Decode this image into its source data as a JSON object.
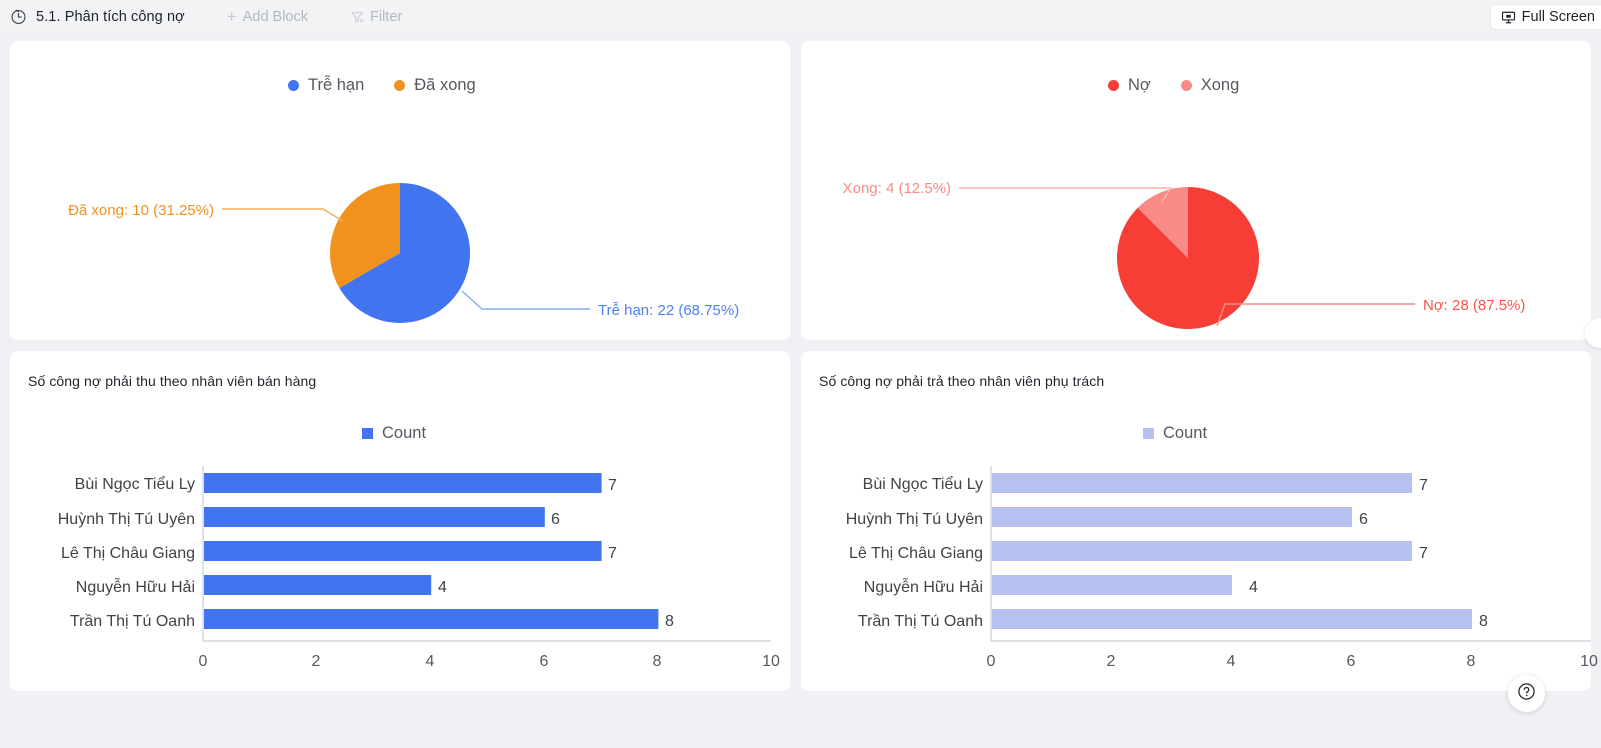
{
  "topbar": {
    "clock_icon": "clock-icon",
    "title": "5.1. Phân tích công nợ",
    "add_block_label": "Add Block",
    "add_block_icon": "plus-icon",
    "filter_label": "Filter",
    "filter_icon": "filter-icon",
    "fullscreen_label": "Full Screen",
    "fullscreen_icon": "presentation-screen-icon"
  },
  "colors": {
    "blue": "#4174ee",
    "orange": "#f1921f",
    "red": "#f73e36",
    "light_red": "#f98b85",
    "light_blue": "#b6c1ef",
    "page_bg": "#f0f1f4",
    "panel_bg": "#ffffff",
    "text": "#1f2329",
    "muted": "#b4b8be"
  },
  "panels": {
    "pie_left": {
      "title": ""
    },
    "pie_right": {
      "title": ""
    },
    "bar_left": {
      "title": "Số công nợ phải thu theo nhân viên bán hàng"
    },
    "bar_right": {
      "title": "Số công nợ phải trả theo nhân viên phụ trách"
    }
  },
  "chart_data": [
    {
      "type": "pie",
      "title": "",
      "legend_position": "top-center",
      "legend": [
        "Trễ hạn",
        "Đã xong"
      ],
      "categories": [
        "Trễ hạn",
        "Đã xong"
      ],
      "values": [
        22,
        10
      ],
      "percentages": [
        68.75,
        31.25
      ],
      "colors": [
        "#4174ee",
        "#f1921f"
      ],
      "labels": [
        "Trễ hạn: 22 (68.75%)",
        "Đã xong: 10 (31.25%)"
      ],
      "total": 32
    },
    {
      "type": "pie",
      "title": "",
      "legend_position": "top-center",
      "legend": [
        "Nợ",
        "Xong"
      ],
      "categories": [
        "Nợ",
        "Xong"
      ],
      "values": [
        28,
        4
      ],
      "percentages": [
        87.5,
        12.5
      ],
      "colors": [
        "#f73e36",
        "#f98b85"
      ],
      "labels": [
        "Nợ: 28 (87.5%)",
        "Xong: 4 (12.5%)"
      ],
      "total": 32
    },
    {
      "type": "bar",
      "orientation": "horizontal",
      "title": "Số công nợ phải thu theo nhân viên bán hàng",
      "legend": [
        "Count"
      ],
      "legend_position": "top-center",
      "categories": [
        "Bùi Ngọc Tiểu Ly",
        "Huỳnh Thị Tú Uyên",
        "Lê Thị Châu Giang",
        "Nguyễn Hữu Hải",
        "Trần Thị Tú Oanh"
      ],
      "values": [
        7,
        6,
        7,
        4,
        8
      ],
      "xticks": [
        "0",
        "2",
        "4",
        "6",
        "8",
        "10"
      ],
      "xlim": [
        0,
        10
      ],
      "xlabel": "",
      "ylabel": "",
      "grid": false,
      "series_color": "#4174ee"
    },
    {
      "type": "bar",
      "orientation": "horizontal",
      "title": "Số công nợ phải trả theo nhân viên phụ trách",
      "legend": [
        "Count"
      ],
      "legend_position": "top-center",
      "categories": [
        "Bùi Ngọc Tiểu Ly",
        "Huỳnh Thị Tú Uyên",
        "Lê Thị Châu Giang",
        "Nguyễn Hữu Hải",
        "Trần Thị Tú Oanh"
      ],
      "values": [
        7,
        6,
        7,
        4,
        8
      ],
      "xticks": [
        "0",
        "2",
        "4",
        "6",
        "8",
        "10"
      ],
      "xlim": [
        0,
        10
      ],
      "xlabel": "",
      "ylabel": "",
      "grid": false,
      "series_color": "#b6c1ef"
    }
  ],
  "widgets": {
    "help_icon": "question-mark-circle-icon"
  }
}
